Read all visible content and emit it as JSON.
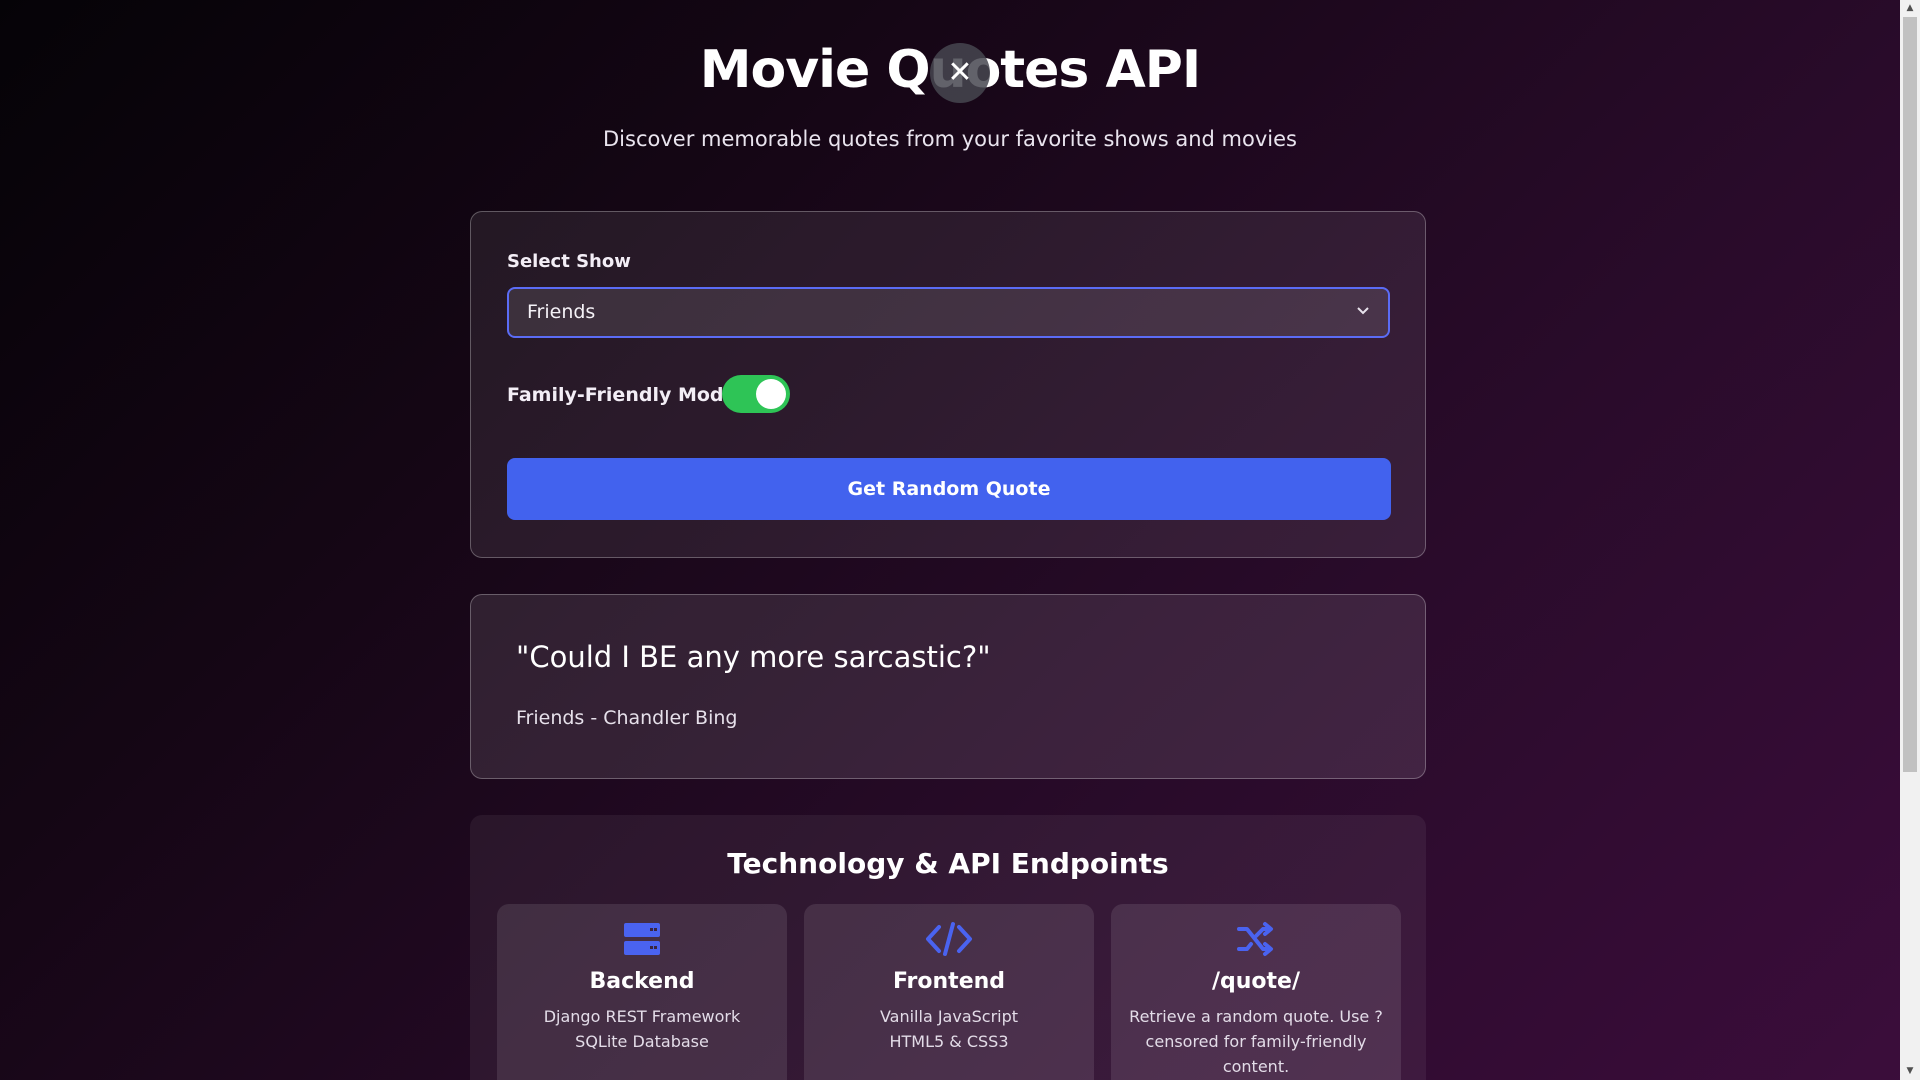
{
  "header": {
    "title": "Movie Quotes API",
    "close_symbol": "✕",
    "subtitle": "Discover memorable quotes from your favorite shows and movies"
  },
  "controls": {
    "select_label": "Select Show",
    "selected_show": "Friends",
    "chevron": "⌄",
    "toggle_label": "Family-Friendly Mode",
    "toggle_on": true,
    "button_label": "Get Random Quote"
  },
  "quote": {
    "text": "\"Could I BE any more sarcastic?\"",
    "show": "Friends",
    "separator": "-",
    "character": "Chandler Bing"
  },
  "tech": {
    "title": "Technology & API Endpoints",
    "cards": [
      {
        "icon": "server-icon",
        "title": "Backend",
        "lines": [
          "Django REST Framework",
          "SQLite Database"
        ]
      },
      {
        "icon": "code-icon",
        "title": "Frontend",
        "lines": [
          "Vanilla JavaScript",
          "HTML5 & CSS3"
        ]
      },
      {
        "icon": "shuffle-icon",
        "title": "/quote/",
        "lines": [
          "Retrieve a random quote. Use ?",
          "censored for family-friendly",
          "content."
        ]
      }
    ]
  },
  "colors": {
    "accent": "#4262ee",
    "toggle_on": "#2ec456",
    "icon": "#4a63f0"
  }
}
